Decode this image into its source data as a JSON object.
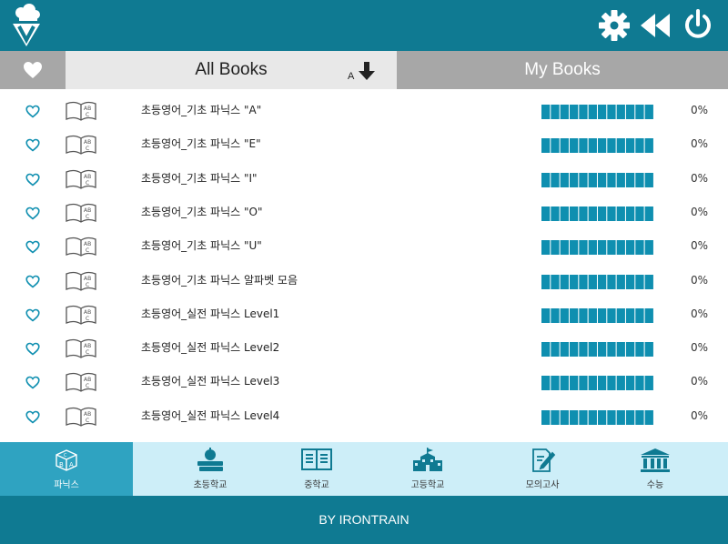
{
  "colors": {
    "header_bg": "#0f7a92",
    "accent": "#0f8fb0",
    "tab_active_bg": "#e8e8e8",
    "tab_inactive_bg": "#a7a7a7",
    "nav_bg": "#cdeef8",
    "nav_active_bg": "#2fa3c1"
  },
  "header": {
    "icons": [
      "logo-icon",
      "gear-icon",
      "rewind-icon",
      "power-icon"
    ]
  },
  "tabs": {
    "favorites_icon": "heart-icon",
    "all_books_label": "All Books",
    "sort_letter": "A",
    "sort_icon": "arrow-down-icon",
    "my_books_label": "My Books"
  },
  "books": [
    {
      "title": "초등영어_기초 파닉스 \"A\"",
      "progress": "0%"
    },
    {
      "title": "초등영어_기초 파닉스 \"E\"",
      "progress": "0%"
    },
    {
      "title": "초등영어_기초 파닉스 \"I\"",
      "progress": "0%"
    },
    {
      "title": "초등영어_기초 파닉스 \"O\"",
      "progress": "0%"
    },
    {
      "title": "초등영어_기초 파닉스 \"U\"",
      "progress": "0%"
    },
    {
      "title": "초등영어_기초 파닉스 알파벳 모음",
      "progress": "0%"
    },
    {
      "title": "초등영어_실전 파닉스 Level1",
      "progress": "0%"
    },
    {
      "title": "초등영어_실전 파닉스 Level2",
      "progress": "0%"
    },
    {
      "title": "초등영어_실전 파닉스 Level3",
      "progress": "0%"
    },
    {
      "title": "초등영어_실전 파닉스 Level4",
      "progress": "0%"
    }
  ],
  "nav": [
    {
      "label": "파닉스",
      "icon": "abc-blocks-icon",
      "active": true
    },
    {
      "label": "초등학교",
      "icon": "apple-books-icon",
      "active": false
    },
    {
      "label": "중학교",
      "icon": "open-book-icon",
      "active": false
    },
    {
      "label": "고등학교",
      "icon": "school-building-icon",
      "active": false
    },
    {
      "label": "모의고사",
      "icon": "exam-paper-icon",
      "active": false
    },
    {
      "label": "수능",
      "icon": "institution-icon",
      "active": false
    }
  ],
  "footer": {
    "text": "BY IRONTRAIN"
  }
}
